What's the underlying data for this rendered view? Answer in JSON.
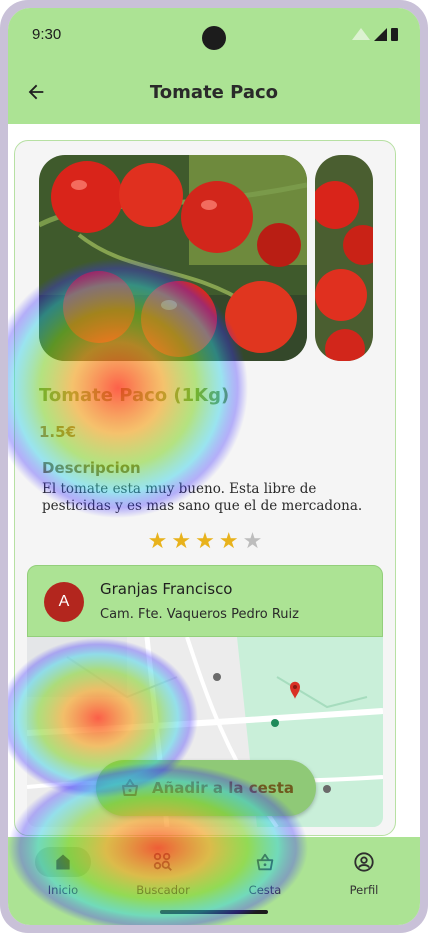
{
  "status_bar": {
    "time": "9:30"
  },
  "app_bar": {
    "title": "Tomate Paco"
  },
  "product": {
    "name": "Tomate Paco (1Kg)",
    "price": "1.5€",
    "description_title": "Descripcion",
    "description": "El tomate esta muy bueno. Esta libre de pesticidas y es mas sano que el de mercadona.",
    "rating": 4,
    "rating_max": 5
  },
  "seller": {
    "avatar_letter": "A",
    "name": "Granjas Francisco",
    "address": "Cam. Fte. Vaqueros Pedro Ruiz"
  },
  "add_to_cart": {
    "label": "Añadir a la cesta"
  },
  "bottom_nav": {
    "items": [
      {
        "label": "Inicio",
        "icon": "home-icon",
        "active": true
      },
      {
        "label": "Buscador",
        "icon": "search-grid-icon",
        "active": false
      },
      {
        "label": "Cesta",
        "icon": "basket-icon",
        "active": false
      },
      {
        "label": "Perfil",
        "icon": "profile-icon",
        "active": false
      }
    ]
  },
  "colors": {
    "primary_green": "#ace394",
    "accent_green": "#8fc977",
    "avatar_red": "#b3261e",
    "star": "#e8b21c"
  }
}
